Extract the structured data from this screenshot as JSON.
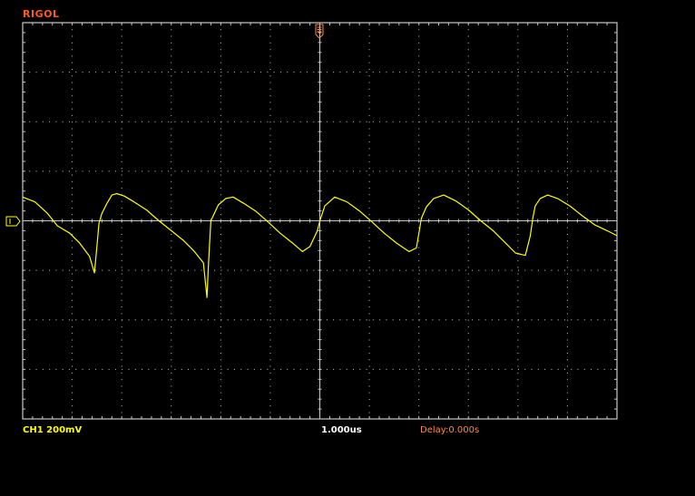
{
  "brand": {
    "name": "RIGOL"
  },
  "status": {
    "channel_label": "CH1 200mV",
    "timebase": "1.000us",
    "delay": "Delay:0.000s"
  },
  "colors": {
    "background": "#000000",
    "trace": "#ffff00",
    "grid": "#c8c8c8",
    "brand": "#ff5a1e",
    "trigger_marker": "#ff8a3c"
  },
  "icons": {
    "trigger_position": "trigger-position-icon",
    "channel_ground": "ch1-ground-marker-icon"
  },
  "chart_data": {
    "type": "line",
    "title": "",
    "xlabel": "",
    "ylabel": "",
    "grid": true,
    "divisions": {
      "horizontal": 12,
      "vertical": 8
    },
    "xlim": [
      -6,
      6
    ],
    "ylim": [
      -4,
      4
    ],
    "series": [
      {
        "color": "#ffff00",
        "x": [
          -6.0,
          -5.75,
          -5.5,
          -5.3,
          -5.05,
          -4.85,
          -4.65,
          -4.55,
          -4.5,
          -4.46,
          -4.4,
          -4.3,
          -4.2,
          -4.1,
          -3.95,
          -3.75,
          -3.5,
          -3.25,
          -3.0,
          -2.75,
          -2.55,
          -2.35,
          -2.28,
          -2.25,
          -2.2,
          -2.05,
          -1.9,
          -1.75,
          -1.55,
          -1.3,
          -1.05,
          -0.8,
          -0.55,
          -0.35,
          -0.2,
          -0.05,
          0.0,
          0.1,
          0.3,
          0.55,
          0.8,
          1.05,
          1.3,
          1.55,
          1.8,
          1.95,
          2.0,
          2.05,
          2.15,
          2.3,
          2.5,
          2.75,
          3.0,
          3.25,
          3.5,
          3.75,
          3.95,
          4.15,
          4.25,
          4.3,
          4.35,
          4.45,
          4.6,
          4.8,
          5.05,
          5.3,
          5.55,
          5.8,
          6.0
        ],
        "y": [
          0.48,
          0.38,
          0.15,
          -0.1,
          -0.25,
          -0.45,
          -0.72,
          -1.05,
          -0.5,
          -0.05,
          0.15,
          0.35,
          0.52,
          0.55,
          0.5,
          0.38,
          0.22,
          0.0,
          -0.2,
          -0.4,
          -0.6,
          -0.85,
          -1.55,
          -0.9,
          0.0,
          0.32,
          0.45,
          0.48,
          0.36,
          0.2,
          -0.02,
          -0.25,
          -0.45,
          -0.62,
          -0.52,
          -0.2,
          0.0,
          0.3,
          0.48,
          0.38,
          0.2,
          -0.02,
          -0.25,
          -0.45,
          -0.62,
          -0.55,
          -0.25,
          0.05,
          0.28,
          0.45,
          0.52,
          0.4,
          0.22,
          0.0,
          -0.2,
          -0.45,
          -0.65,
          -0.7,
          -0.3,
          0.05,
          0.3,
          0.45,
          0.52,
          0.45,
          0.3,
          0.1,
          -0.08,
          -0.2,
          -0.3
        ]
      }
    ]
  }
}
